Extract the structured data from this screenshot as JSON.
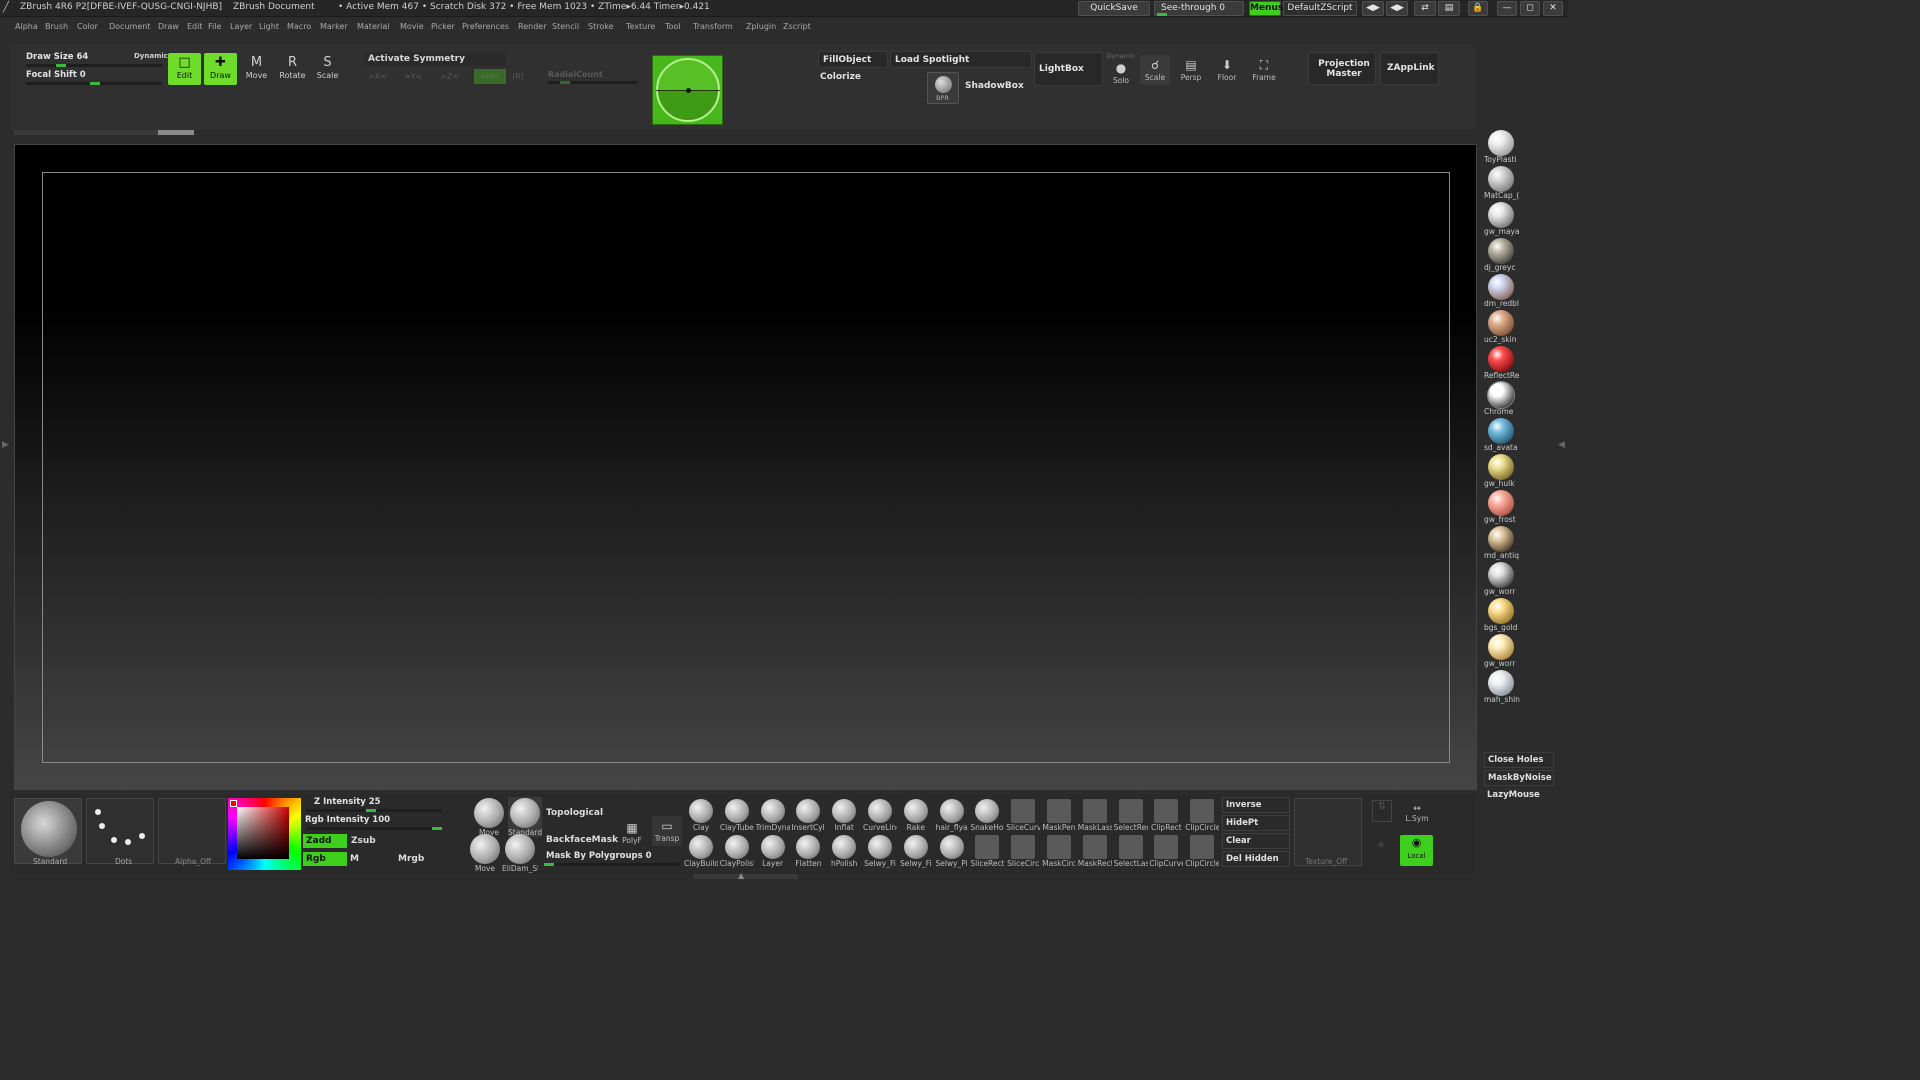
{
  "titlebar": {
    "app": "ZBrush 4R6  P2[DFBE-IVEF-QUSG-CNGI-NJHB]",
    "doc": "ZBrush Document",
    "stats": "• Active Mem 467 • Scratch Disk 372 • Free Mem 1023 • ZTime▸6.44 Timer▸0.421",
    "quicksave": "QuickSave",
    "seethrough": "See-through   0",
    "menus": "Menus",
    "defaultzscript": "DefaultZScript"
  },
  "menubar": [
    "Alpha",
    "Brush",
    "Color",
    "Document",
    "Draw",
    "Edit",
    "File",
    "Layer",
    "Light",
    "Macro",
    "Marker",
    "Material",
    "Movie",
    "Picker",
    "Preferences",
    "Render",
    "Stencil",
    "Stroke",
    "Texture",
    "Tool",
    "Transform",
    "Zplugin",
    "Zscript"
  ],
  "shelf": {
    "draw_size": "Draw Size 64",
    "dynamic": "Dynamic",
    "focal_shift": "Focal Shift 0",
    "edit": "Edit",
    "draw": "Draw",
    "move": "Move",
    "rotate": "Rotate",
    "scale": "Scale",
    "activate_symmetry": "Activate Symmetry",
    "sym_x": ">X<",
    "sym_y": ">Y<",
    "sym_z": ">Z<",
    "sym_m": ">M<",
    "sym_r": "(R)",
    "radialcount": "RadialCount",
    "fillobject": "FillObject",
    "load_spotlight": "Load Spotlight",
    "colorize": "Colorize",
    "lightbox": "LightBox",
    "bpr": "BPR",
    "shadowbox": "ShadowBox",
    "solo_dynamic": "Dynamic",
    "solo": "Solo",
    "scale2": "Scale",
    "persp": "Persp",
    "floor": "Floor",
    "frame": "Frame",
    "projection_master": "Projection Master",
    "zapplink": "ZAppLink"
  },
  "materials": [
    {
      "name": "ToyPlasti",
      "c1": "#f0f0f0",
      "c2": "#8a8a8a"
    },
    {
      "name": "MatCap_(",
      "c1": "#d8d8d8",
      "c2": "#6a6a6a"
    },
    {
      "name": "gw_maya",
      "c1": "#e8e8e8",
      "c2": "#5a5a5a"
    },
    {
      "name": "dj_greyc",
      "c1": "#c0b8a8",
      "c2": "#2a2a2a"
    },
    {
      "name": "dm_redbl",
      "c1": "#cfd8f0",
      "c2": "#7a5040"
    },
    {
      "name": "uc2_skin",
      "c1": "#e0b090",
      "c2": "#6a3a20"
    },
    {
      "name": "ReflectRe",
      "c1": "#ff5050",
      "c2": "#700000"
    },
    {
      "name": "Chrome",
      "c1": "#ffffff",
      "c2": "#101010"
    },
    {
      "name": "sd_avata",
      "c1": "#7ac0e0",
      "c2": "#104060"
    },
    {
      "name": "gw_hulk",
      "c1": "#f0e090",
      "c2": "#605010"
    },
    {
      "name": "gw_frost",
      "c1": "#ffb0a0",
      "c2": "#a04030"
    },
    {
      "name": "md_antiq",
      "c1": "#e0c8a0",
      "c2": "#302010"
    },
    {
      "name": "gw_worr",
      "c1": "#e0e0e0",
      "c2": "#202020"
    },
    {
      "name": "bgs_gold",
      "c1": "#ffe090",
      "c2": "#806010"
    },
    {
      "name": "gw_worr",
      "c1": "#fff0c0",
      "c2": "#a07020"
    },
    {
      "name": "mah_shin",
      "c1": "#f0f0f0",
      "c2": "#708090"
    }
  ],
  "right_panel": {
    "close_holes": "Close Holes",
    "maskbynoise": "MaskByNoise",
    "lazymouse": "LazyMouse"
  },
  "bottom": {
    "brush_standard": "Standard",
    "stroke_dots": "Dots",
    "alpha_off": "Alpha_Off",
    "z_intensity": "Z Intensity 25",
    "rgb_intensity": "Rgb Intensity 100",
    "zadd": "Zadd",
    "zsub": "Zsub",
    "rgb": "Rgb",
    "m": "M",
    "mrgb": "Mrgb",
    "move": "Move",
    "standard": "Standard",
    "move2": "Move",
    "elidam": "EliDam_Sta",
    "topological": "Topological",
    "backfacemask": "BackfaceMask",
    "mask_by_polygroups": "Mask By Polygroups 0",
    "polyf": "PolyF",
    "transp": "Transp",
    "brushes_row1": [
      "Clay",
      "ClayTube",
      "TrimDyna",
      "InsertCyli",
      "Inflat",
      "CurveLine",
      "Rake",
      "hair_flya",
      "SnakeHoo",
      "SliceCurv",
      "MaskPen",
      "MaskLass",
      "SelectRec",
      "ClipRect",
      "ClipCircle"
    ],
    "brushes_row2": [
      "ClayBuild",
      "ClayPolist",
      "Layer",
      "Flatten",
      "hPolish",
      "Selwy_Fi",
      "Selwy_Fi",
      "Selwy_Pi",
      "SliceRect",
      "SliceCirc",
      "MaskCirc",
      "MaskRect",
      "SelectLas",
      "ClipCurve",
      "ClipCircle"
    ],
    "inverse": "Inverse",
    "hidept": "HidePt",
    "clear": "Clear",
    "del_hidden": "Del Hidden",
    "texture_off": "Texture_Off",
    "lsym": "L.Sym",
    "local": "Local"
  }
}
